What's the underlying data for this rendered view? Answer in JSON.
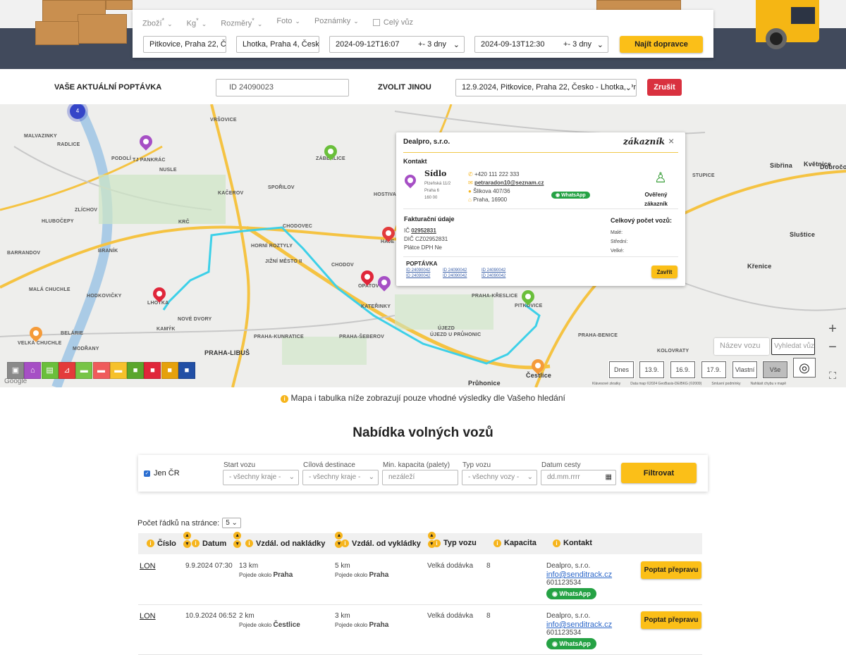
{
  "search": {
    "tabs": [
      {
        "label": "Zboží",
        "asterisk": "*"
      },
      {
        "label": "Kg",
        "asterisk": "*"
      },
      {
        "label": "Rozměry",
        "asterisk": "*"
      },
      {
        "label": "Foto",
        "asterisk": ""
      },
      {
        "label": "Poznámky",
        "asterisk": ""
      }
    ],
    "whole_car_label": "Celý vůz",
    "from_value": "Pitkovice, Praha 22, Č",
    "to_value": "Lhotka, Praha 4, Česk",
    "date_from": "2024-09-12T16:07",
    "date_from_range": "+- 3 dny",
    "date_to": "2024-09-13T12:30",
    "date_to_range": "+- 3 dny",
    "find_button": "Najít dopravce"
  },
  "request_bar": {
    "current_label": "VAŠE AKTUÁLNÍ POPTÁVKA",
    "id_value": "ID 24090023",
    "choose_label": "ZVOLIT JINOU",
    "choose_value": "12.9.2024, Pitkovice, Praha 22, Česko - Lhotka, Pr",
    "cancel_button": "Zrušit"
  },
  "map": {
    "cluster_count": "4",
    "towns": [
      "MALVAZINKY",
      "RADLICE",
      "PODOLÍ",
      "TJ PANKRÁC",
      "NUSLE",
      "VRŠOVICE",
      "ZÁBĚHLICE",
      "HOSTIVAŘ",
      "KAČEROV",
      "SPOŘILOV",
      "ZLÍCHOV",
      "HLUBOČEPY",
      "KRČ",
      "CHODOVEC",
      "HORNÍ ROZTYLY",
      "JIŽNÍ MĚSTO II",
      "CHODOV",
      "HÁJE",
      "OPATOV",
      "KATEŘINKY",
      "BARRANDOV",
      "BRANÍK",
      "MALÁ CHUCHLE",
      "HODKOVIČKY",
      "LHOTKA",
      "NOVÉ DVORY",
      "KAMÝK",
      "VELKÁ CHUCHLE",
      "BELÁRIE",
      "MODŘANY",
      "PRAHA-LIBUŠ",
      "PRAHA-KUNRATICE",
      "PRAHA-ŠEBEROV",
      "ÚJEZD",
      "ÚJEZD U PRŮHONIC",
      "PRAHA-KŘESLICE",
      "PITKOVICE",
      "PRAHA-BENICE",
      "KOLOVRATY",
      "Průhonice",
      "Čestlice",
      "STUPICE",
      "Sibřina",
      "Květnice",
      "Dobročovice",
      "Sluštice",
      "Křenice"
    ],
    "vehicle_name_placeholder": "Název vozu",
    "vehicle_search_placeholder": "Vyhledat vůz",
    "date_buttons": [
      "Dnes",
      "13.9.",
      "16.9.",
      "17.9.",
      "Vlastní",
      "Vše"
    ],
    "attribution": [
      "Klávesové zkratky",
      "Data map ©2024 GeoBasis-DE/BKG (©2009)",
      "Smluvní podmínky",
      "Nahlásit chybu v mapě"
    ],
    "google": "Google",
    "legend_colors": [
      "#8a8a8a",
      "#a64fc5",
      "#6abf3b",
      "#e33b3b",
      "#77c447",
      "#ef5b5b",
      "#f6c12b",
      "#5aa62c",
      "#e0263a",
      "#e5a10c",
      "#214fa5"
    ]
  },
  "popup": {
    "company": "Dealpro, s.r.o.",
    "badge": "zákazník",
    "contact_heading": "Kontakt",
    "seat_title": "Sídlo",
    "seat_lines": [
      "Plzeňská 11/2",
      "Praha 6",
      "160 00"
    ],
    "phone": "+420 111 222 333",
    "email": "petraradon10@seznam.cz",
    "street": "Šlikova 407/36",
    "city": "Praha, 16900",
    "whatsapp": "WhatsApp",
    "verified_line1": "Ověřený",
    "verified_line2": "zákazník",
    "billing_heading": "Fakturační údaje",
    "ic_label": "IČ",
    "ic_value": "02952831",
    "dic_line": "DIČ CZ02952831",
    "vat_line": "Plátce DPH Ne",
    "cars_heading": "Celkový počet vozů:",
    "cars_small": "Malé:",
    "cars_medium": "Střední:",
    "cars_large": "Velké:",
    "requests_heading": "POPTÁVKA",
    "request_ids": [
      "ID 24090042",
      "ID 24090042",
      "ID 24090042",
      "ID 24090042",
      "ID 24090042",
      "ID 24090042"
    ],
    "close_button": "Zavřít"
  },
  "notice": "Mapa i tabulka níže zobrazují pouze vhodné výsledky dle Vašeho hledání",
  "offers": {
    "title": "Nabídka volných vozů",
    "filter": {
      "only_cz": "Jen ČR",
      "start_label": "Start vozu",
      "start_value": "- všechny kraje -",
      "dest_label": "Cílová destinace",
      "dest_value": "- všechny kraje -",
      "capacity_label": "Min. kapacita (palety)",
      "capacity_placeholder": "nezáleží",
      "type_label": "Typ vozu",
      "type_value": "- všechny vozy -",
      "date_label": "Datum cesty",
      "date_placeholder": "dd.mm.rrrr",
      "button": "Filtrovat"
    },
    "rows_label": "Počet řádků na stránce:",
    "rows_value": "5",
    "columns": [
      "Číslo",
      "Datum",
      "Vzdál. od nakládky",
      "Vzdál. od vykládky",
      "Typ vozu",
      "Kapacita",
      "Kontakt"
    ],
    "rows": [
      {
        "id": "LON",
        "date": "9.9.2024 07:30",
        "load_km": "13 km",
        "load_around": "Pojede okolo",
        "load_place": "Praha",
        "unload_km": "5 km",
        "unload_around": "Pojede okolo",
        "unload_place": "Praha",
        "type": "Velká dodávka",
        "capacity": "8",
        "company": "Dealpro, s.r.o.",
        "email": "info@senditrack.cz",
        "phone": "601123534",
        "whatsapp": "WhatsApp",
        "button": "Poptat přepravu"
      },
      {
        "id": "LON",
        "date": "10.9.2024 06:52",
        "load_km": "2 km",
        "load_around": "Pojede okolo",
        "load_place": "Čestlice",
        "unload_km": "3 km",
        "unload_around": "Pojede okolo",
        "unload_place": "Praha",
        "type": "Velká dodávka",
        "capacity": "8",
        "company": "Dealpro, s.r.o.",
        "email": "info@senditrack.cz",
        "phone": "601123534",
        "whatsapp": "WhatsApp",
        "button": "Poptat přepravu"
      }
    ]
  }
}
